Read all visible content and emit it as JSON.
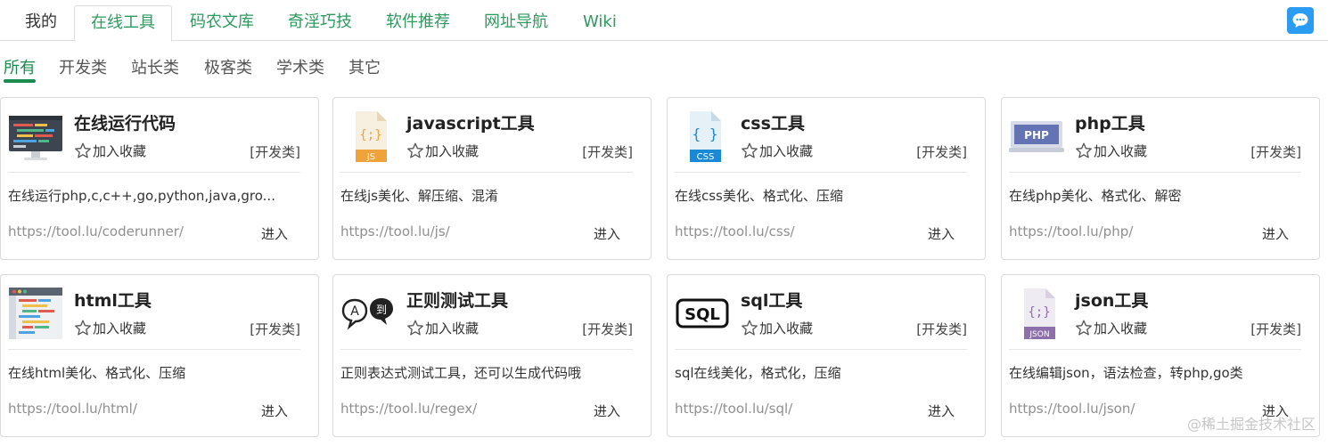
{
  "top_tabs": [
    {
      "label": "我的"
    },
    {
      "label": "在线工具"
    },
    {
      "label": "码农文库"
    },
    {
      "label": "奇淫巧技"
    },
    {
      "label": "软件推荐"
    },
    {
      "label": "网址导航"
    },
    {
      "label": "Wiki"
    }
  ],
  "filters": [
    {
      "label": "所有"
    },
    {
      "label": "开发类"
    },
    {
      "label": "站长类"
    },
    {
      "label": "极客类"
    },
    {
      "label": "学术类"
    },
    {
      "label": "其它"
    }
  ],
  "fav_label": "加入收藏",
  "enter_label": "进入",
  "cards": [
    {
      "title": "在线运行代码",
      "category": "[开发类]",
      "desc": "在线运行php,c,c++,go,python,java,gro...",
      "url": "https://tool.lu/coderunner/",
      "icon": "code-editor-icon"
    },
    {
      "title": "javascript工具",
      "category": "[开发类]",
      "desc": "在线js美化、解压缩、混淆",
      "url": "https://tool.lu/js/",
      "icon": "js-file-icon",
      "icon_text": "JS"
    },
    {
      "title": "css工具",
      "category": "[开发类]",
      "desc": "在线css美化、格式化、压缩",
      "url": "https://tool.lu/css/",
      "icon": "css-file-icon",
      "icon_text": "CSS"
    },
    {
      "title": "php工具",
      "category": "[开发类]",
      "desc": "在线php美化、格式化、解密",
      "url": "https://tool.lu/php/",
      "icon": "php-icon",
      "icon_text": "PHP"
    },
    {
      "title": "html工具",
      "category": "[开发类]",
      "desc": "在线html美化、格式化、压缩",
      "url": "https://tool.lu/html/",
      "icon": "html-editor-icon"
    },
    {
      "title": "正则测试工具",
      "category": "[开发类]",
      "desc": "正则表达式测试工具，还可以生成代码哦",
      "url": "https://tool.lu/regex/",
      "icon": "regex-icon",
      "icon_text_a": "A",
      "icon_text_b": "到"
    },
    {
      "title": "sql工具",
      "category": "[开发类]",
      "desc": "sql在线美化，格式化，压缩",
      "url": "https://tool.lu/sql/",
      "icon": "sql-icon",
      "icon_text": "SQL"
    },
    {
      "title": "json工具",
      "category": "[开发类]",
      "desc": "在线编辑json，语法检查，转php,go类",
      "url": "https://tool.lu/json/",
      "icon": "json-file-icon",
      "icon_text": "JSON"
    }
  ],
  "watermark": "@稀土掘金技术社区",
  "colors": {
    "accent_green": "#1b8c4f",
    "chat_blue": "#2b9cf2",
    "js_orange": "#f0a23b",
    "css_blue": "#1a8ad4",
    "php_purple": "#6373b3",
    "json_purple": "#8f6fab"
  }
}
